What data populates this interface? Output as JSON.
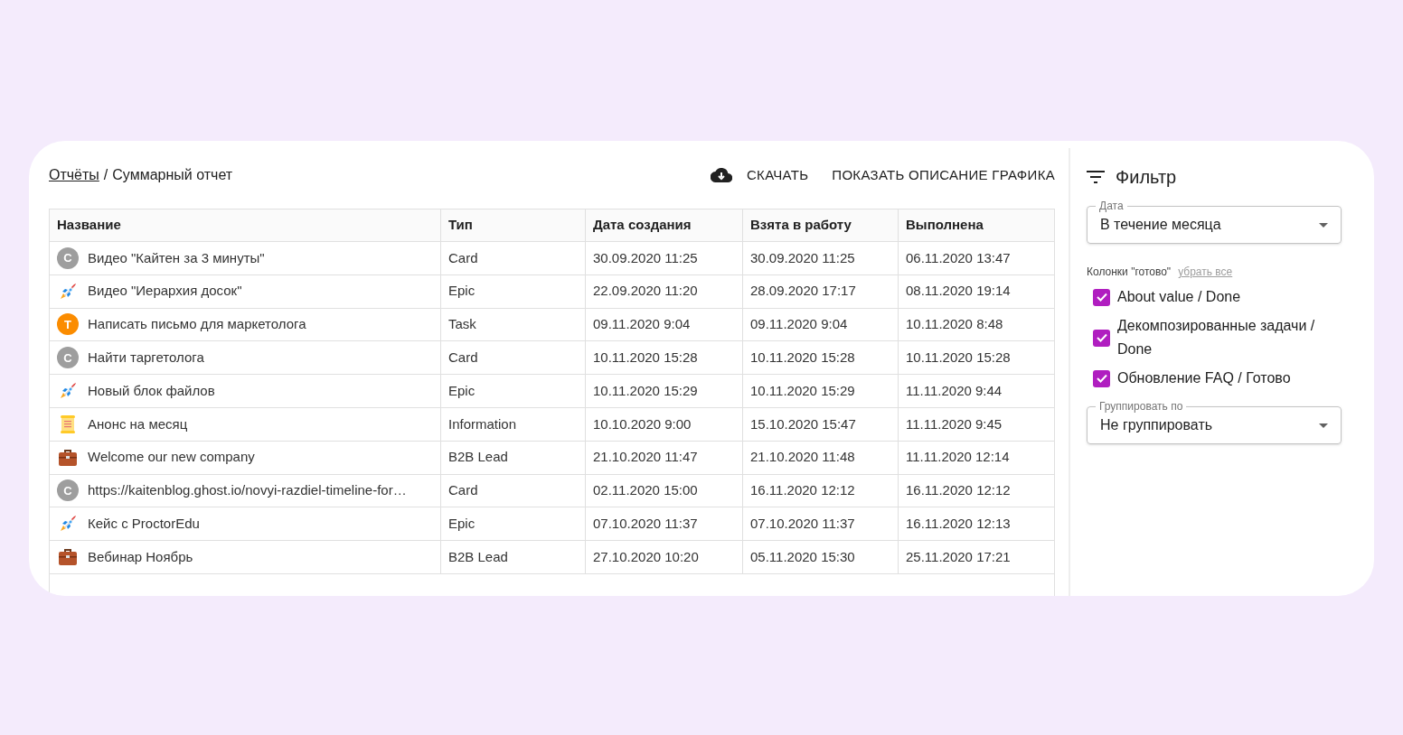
{
  "breadcrumb": {
    "link": "Отчёты",
    "separator": "/",
    "current": "Суммарный отчет"
  },
  "actions": [
    {
      "kind": "download",
      "label": "СКАЧАТЬ"
    },
    {
      "kind": "plain",
      "label": "ПОКАЗАТЬ ОПИСАНИЕ ГРАФИКА"
    }
  ],
  "table": {
    "columns": [
      "Название",
      "Тип",
      "Дата создания",
      "Взята в работу",
      "Выполнена"
    ],
    "rows": [
      {
        "icon": {
          "kind": "avatar",
          "letter": "C",
          "color": "#9e9e9e"
        },
        "cells": [
          "Видео \"Кайтен за 3 минуты\"",
          "Card",
          "30.09.2020 11:25",
          "30.09.2020 11:25",
          "06.11.2020 13:47"
        ]
      },
      {
        "icon": {
          "kind": "rocket"
        },
        "cells": [
          "Видео \"Иерархия досок\"",
          "Epic",
          "22.09.2020 11:20",
          "28.09.2020 17:17",
          "08.11.2020 19:14"
        ]
      },
      {
        "icon": {
          "kind": "avatar",
          "letter": "T",
          "color": "#fb8c00"
        },
        "cells": [
          "Написать письмо для маркетолога",
          "Task",
          "09.11.2020 9:04",
          "09.11.2020 9:04",
          "10.11.2020 8:48"
        ]
      },
      {
        "icon": {
          "kind": "avatar",
          "letter": "C",
          "color": "#9e9e9e"
        },
        "cells": [
          "Найти таргетолога",
          "Card",
          "10.11.2020 15:28",
          "10.11.2020 15:28",
          "10.11.2020 15:28"
        ]
      },
      {
        "icon": {
          "kind": "rocket"
        },
        "cells": [
          "Новый блок файлов",
          "Epic",
          "10.11.2020 15:29",
          "10.11.2020 15:29",
          "11.11.2020 9:44"
        ]
      },
      {
        "icon": {
          "kind": "scroll"
        },
        "cells": [
          "Анонс на месяц",
          "Information",
          "10.10.2020 9:00",
          "15.10.2020 15:47",
          "11.11.2020 9:45"
        ]
      },
      {
        "icon": {
          "kind": "briefcase"
        },
        "cells": [
          "Welcome our new company",
          "B2B Lead",
          "21.10.2020 11:47",
          "21.10.2020 11:48",
          "11.11.2020 12:14"
        ]
      },
      {
        "icon": {
          "kind": "avatar",
          "letter": "C",
          "color": "#9e9e9e"
        },
        "cells": [
          "https://kaitenblog.ghost.io/novyi-razdiel-timeline-for…",
          "Card",
          "02.11.2020 15:00",
          "16.11.2020 12:12",
          "16.11.2020 12:12"
        ]
      },
      {
        "icon": {
          "kind": "rocket"
        },
        "cells": [
          "Кейс с ProctorEdu",
          "Epic",
          "07.10.2020 11:37",
          "07.10.2020 11:37",
          "16.11.2020 12:13"
        ]
      },
      {
        "icon": {
          "kind": "briefcase"
        },
        "cells": [
          "Вебинар Ноябрь",
          "B2B Lead",
          "27.10.2020 10:20",
          "05.11.2020 15:30",
          "25.11.2020 17:21"
        ]
      }
    ]
  },
  "filter": {
    "title": "Фильтр",
    "date": {
      "label": "Дата",
      "value": "В течение месяца"
    },
    "columns_label": "Колонки \"готово\"",
    "clear_link": "убрать все",
    "checkboxes": [
      {
        "label": "About value / Done",
        "checked": true
      },
      {
        "label": "Декомпозированные задачи / Done",
        "checked": true
      },
      {
        "label": "Обновление FAQ / Готово",
        "checked": true
      }
    ],
    "group": {
      "label": "Группировать по",
      "value": "Не группировать"
    }
  }
}
